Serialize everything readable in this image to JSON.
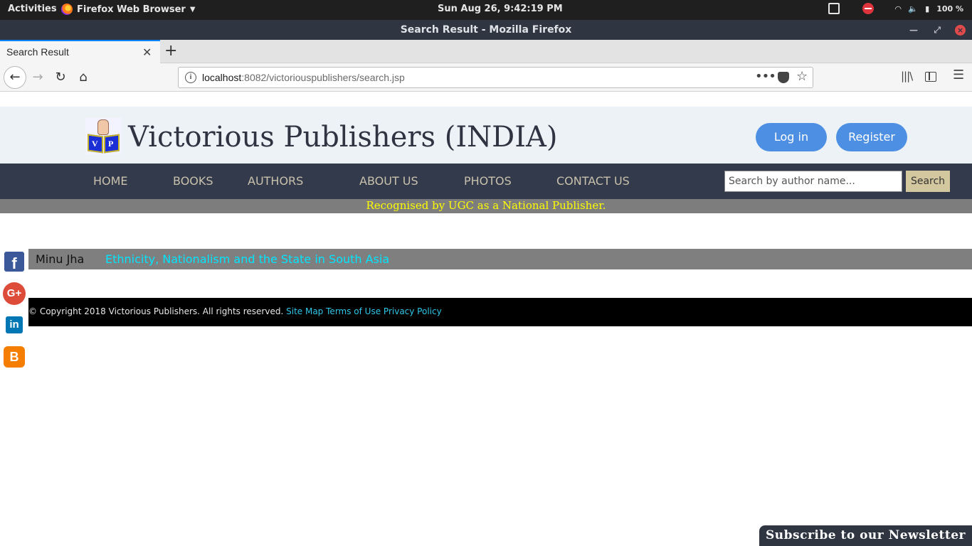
{
  "os_bar": {
    "activities": "Activities",
    "app_name": "Firefox Web Browser",
    "clock": "Sun Aug 26,  9:42:19 PM",
    "battery": "100 %"
  },
  "window": {
    "title": "Search Result - Mozilla Firefox"
  },
  "tabs": [
    {
      "label": "Search Result"
    }
  ],
  "address_bar": {
    "host": "localhost",
    "rest": ":8082/victoriouspublishers/search.jsp"
  },
  "site": {
    "title": "Victorious Publishers (INDIA)",
    "logo_letters": [
      "V",
      "P"
    ],
    "login_label": "Log in",
    "register_label": "Register",
    "nav": [
      "HOME",
      "BOOKS",
      "AUTHORS",
      "ABOUT US",
      "PHOTOS",
      "CONTACT US"
    ],
    "search": {
      "placeholder": "Search by author name...",
      "button": "Search"
    },
    "banner": "Recognised by UGC as a National Publisher."
  },
  "results": [
    {
      "author": "Minu Jha",
      "title": "Ethnicity, Nationalism and the State in South Asia"
    }
  ],
  "footer": {
    "copyright": "© Copyright 2018 Victorious Publishers. All rights reserved.",
    "links": [
      "Site Map",
      "Terms of Use",
      "Privacy Policy"
    ]
  },
  "social": [
    "f",
    "G+",
    "in",
    "B"
  ],
  "newsletter": "Subscribe to our Newsletter",
  "colors": {
    "header_bg": "#edf2f7",
    "menubar_bg": "#333a4c",
    "accent_blue": "#4d90e3",
    "banner_text": "#ffff00",
    "result_title": "#00e5ff"
  }
}
